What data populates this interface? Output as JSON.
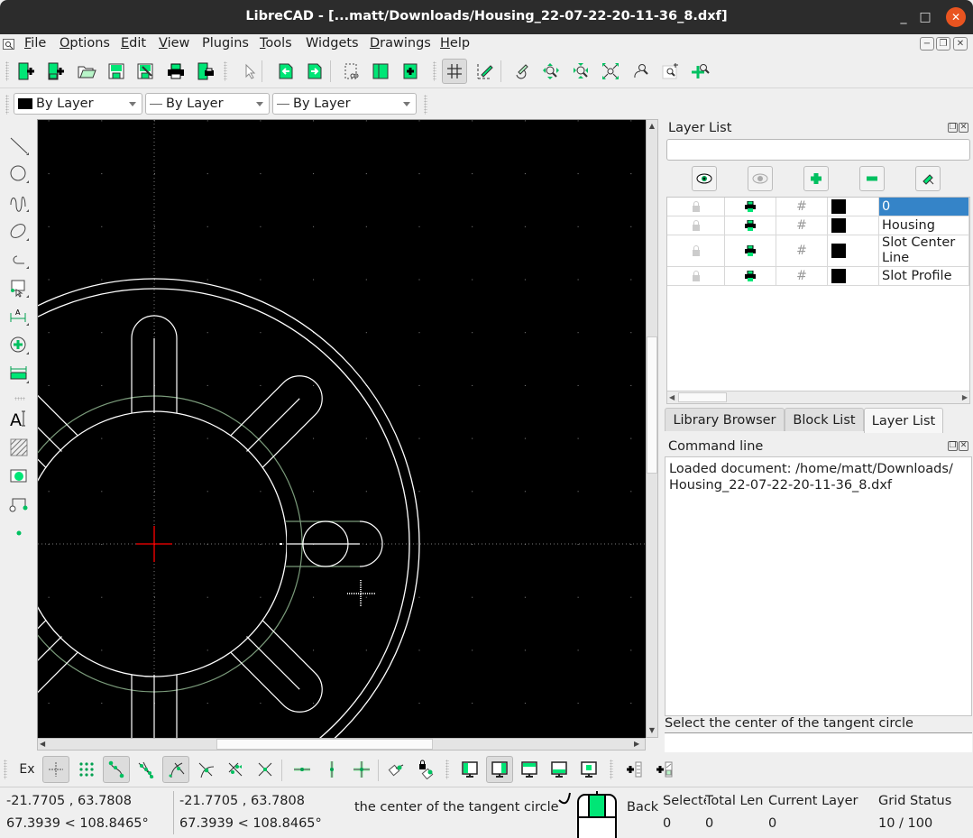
{
  "window": {
    "title": "LibreCAD - [...matt/Downloads/Housing_22-07-22-20-11-36_8.dxf]",
    "minimize": "_",
    "maximize": "□",
    "close": "✕"
  },
  "menubar": {
    "items": [
      {
        "label": "File",
        "accel": "F",
        "rest": "ile"
      },
      {
        "label": "Options",
        "accel": "O",
        "rest": "ptions"
      },
      {
        "label": "Edit",
        "accel": "E",
        "rest": "dit"
      },
      {
        "label": "View",
        "accel": "V",
        "rest": "iew"
      },
      {
        "label": "Plugins",
        "accel": "",
        "rest": "Plugins"
      },
      {
        "label": "Tools",
        "accel": "T",
        "rest": "ools"
      },
      {
        "label": "Widgets",
        "accel": "",
        "rest": "Widgets"
      },
      {
        "label": "Drawings",
        "accel": "D",
        "rest": "rawings"
      },
      {
        "label": "Help",
        "accel": "H",
        "rest": "elp"
      }
    ]
  },
  "toolbar": {
    "items": [
      "new-file",
      "new-from-template",
      "open",
      "save",
      "save-as",
      "print",
      "print-preview",
      "select-pointer",
      "undo",
      "redo",
      "cut",
      "copy",
      "paste",
      "grid-toggle",
      "draft-mode",
      "redraw",
      "zoom-in",
      "zoom-out",
      "zoom-auto",
      "zoom-previous",
      "zoom-window",
      "zoom-pan"
    ]
  },
  "pen_toolbar": {
    "color": "By Layer",
    "width": "By Layer",
    "linetype": "By Layer"
  },
  "left_toolbar": {
    "items": [
      "line",
      "circle",
      "curve",
      "ellipse",
      "polyline",
      "select",
      "dimension",
      "modify",
      "measure",
      "text",
      "hatch",
      "image",
      "block",
      "point"
    ]
  },
  "layer_list": {
    "title": "Layer List",
    "filter_value": "",
    "buttons": [
      "show-all-layers",
      "hide-all-layers",
      "add-layer",
      "remove-layer",
      "edit-layer"
    ],
    "layers": [
      {
        "name": "0",
        "selected": true
      },
      {
        "name": "Housing",
        "selected": false
      },
      {
        "name": "Slot Center Line",
        "selected": false
      },
      {
        "name": "Slot Profile",
        "selected": false
      }
    ]
  },
  "dock_tabs": [
    {
      "label": "Library Browser",
      "active": false
    },
    {
      "label": "Block List",
      "active": false
    },
    {
      "label": "Layer List",
      "active": true
    }
  ],
  "command_line": {
    "title": "Command line",
    "history_line1": "Loaded document: /home/matt/Downloads/",
    "history_line2": "Housing_22-07-22-20-11-36_8.dxf",
    "prompt": "Select the center of the tangent circle",
    "input_value": ""
  },
  "snap_toolbar": {
    "exclusive_label": "Ex",
    "items": [
      "snap-free",
      "snap-grid",
      "snap-endpoints",
      "snap-on-entity",
      "snap-center",
      "snap-middle",
      "snap-distance",
      "snap-intersection",
      "restrict-horizontal",
      "restrict-vertical",
      "restrict-orthogonal",
      "relative-zero",
      "lock-relative-zero",
      "view-1",
      "view-2",
      "view-3",
      "view-4",
      "view-5",
      "add-layer-list",
      "add-block"
    ]
  },
  "status": {
    "abs_coords": "-21.7705 , 63.7808",
    "abs_polar": "67.3939 < 108.8465°",
    "rel_coords": "-21.7705 , 63.7808",
    "rel_polar": "67.3939 < 108.8465°",
    "left_mouse_hint": "the center of the tangent circle",
    "right_mouse_hint": "Back",
    "selected_label": "Selected",
    "selected_value": "0",
    "total_length_label": "Total Len",
    "total_length_value": "0",
    "current_layer_label": "Current Layer",
    "current_layer_value": "0",
    "grid_status_label": "Grid Status",
    "grid_status_value": "10 / 100"
  },
  "colors": {
    "accent_green": "#00e676",
    "canvas_bg": "#000000",
    "entity_white": "#ffffff",
    "construction_green": "#7a9a7a",
    "origin_red": "#ff0000",
    "selection_blue": "#3584c8",
    "close_orange": "#e95420"
  }
}
